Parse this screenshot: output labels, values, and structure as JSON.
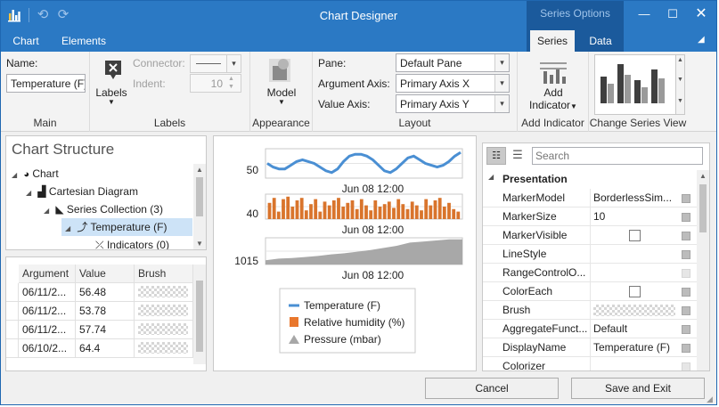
{
  "window": {
    "title": "Chart Designer",
    "context_header": "Series Options"
  },
  "tabs": [
    {
      "label": "Chart"
    },
    {
      "label": "Elements"
    },
    {
      "label": "Series"
    },
    {
      "label": "Data"
    }
  ],
  "ribbon": {
    "main": {
      "name_label": "Name:",
      "name_value": "Temperature (F)",
      "group": "Main"
    },
    "labels": {
      "button": "Labels",
      "connector_label": "Connector:",
      "indent_label": "Indent:",
      "indent_value": "10",
      "group": "Labels"
    },
    "appearance": {
      "button": "Model",
      "group": "Appearance"
    },
    "layout": {
      "pane_label": "Pane:",
      "pane_value": "Default Pane",
      "arg_axis_label": "Argument Axis:",
      "arg_axis_value": "Primary Axis X",
      "val_axis_label": "Value Axis:",
      "val_axis_value": "Primary Axis Y",
      "group": "Layout"
    },
    "add_indicator": {
      "button_line1": "Add",
      "button_line2": "Indicator",
      "group": "Add Indicator"
    },
    "change_view": {
      "group": "Change Series View"
    }
  },
  "structure": {
    "title": "Chart Structure",
    "items": [
      {
        "label": "Chart"
      },
      {
        "label": "Cartesian Diagram"
      },
      {
        "label": "Series Collection (3)"
      },
      {
        "label": "Temperature (F)"
      },
      {
        "label": "Indicators (0)"
      }
    ]
  },
  "data_grid": {
    "columns": [
      "Argument",
      "Value",
      "Brush"
    ],
    "rows": [
      {
        "argument": "06/11/2...",
        "value": "56.48"
      },
      {
        "argument": "06/11/2...",
        "value": "53.78"
      },
      {
        "argument": "06/11/2...",
        "value": "57.74"
      },
      {
        "argument": "06/10/2...",
        "value": "64.4"
      }
    ]
  },
  "chart_data": {
    "type": "line",
    "panes": [
      {
        "series": "Temperature (F)",
        "type": "line",
        "y_tick": "50",
        "x_tick": "Jun 08 12:00",
        "color": "#4a8fd3"
      },
      {
        "series": "Relative humidity (%)",
        "type": "bar",
        "y_tick": "40",
        "x_tick": "Jun 08 12:00",
        "color": "#d9742c"
      },
      {
        "series": "Pressure (mbar)",
        "type": "area",
        "y_tick": "1015",
        "x_tick": "Jun 08 12:00",
        "color": "#a8a8a8"
      }
    ],
    "temperature_profile": [
      52,
      50,
      49,
      49,
      51,
      53,
      54,
      53,
      52,
      50,
      48,
      47,
      49,
      53,
      56,
      57,
      57,
      56,
      54,
      51,
      48,
      47,
      49,
      52,
      55,
      56,
      54,
      52,
      51,
      50,
      51,
      53,
      56,
      58
    ],
    "humidity_profile": [
      43,
      47,
      36,
      46,
      48,
      40,
      45,
      47,
      37,
      42,
      46,
      36,
      44,
      41,
      45,
      47,
      40,
      43,
      45,
      38,
      46,
      41,
      37,
      45,
      40,
      42,
      44,
      39,
      46,
      42,
      38,
      44,
      41,
      37,
      46,
      41,
      45,
      47,
      40,
      43,
      38,
      36
    ],
    "pressure_profile": [
      1013.3,
      1013.6,
      1013.7,
      1013.9,
      1014.1,
      1014.4,
      1014.6,
      1014.9,
      1015.2,
      1015.6,
      1016.0,
      1016.6,
      1016.8,
      1017.0,
      1017.2,
      1017.2
    ]
  },
  "legend": {
    "items": [
      {
        "label": "Temperature (F)",
        "color": "#4a8fd3"
      },
      {
        "label": "Relative humidity (%)",
        "color": "#e9772d"
      },
      {
        "label": "Pressure (mbar)",
        "color": "#a7a7a7"
      }
    ]
  },
  "properties": {
    "search_placeholder": "Search",
    "category": "Presentation",
    "rows": [
      {
        "name": "MarkerModel",
        "value": "BorderlessSim..."
      },
      {
        "name": "MarkerSize",
        "value": "10"
      },
      {
        "name": "MarkerVisible",
        "value": ""
      },
      {
        "name": "LineStyle",
        "value": ""
      },
      {
        "name": "RangeControlO...",
        "value": ""
      },
      {
        "name": "ColorEach",
        "value": ""
      },
      {
        "name": "Brush",
        "value": ""
      },
      {
        "name": "AggregateFunct...",
        "value": "Default"
      },
      {
        "name": "DisplayName",
        "value": "Temperature (F)"
      },
      {
        "name": "Colorizer",
        "value": ""
      }
    ]
  },
  "buttons": {
    "cancel": "Cancel",
    "save": "Save and Exit"
  }
}
